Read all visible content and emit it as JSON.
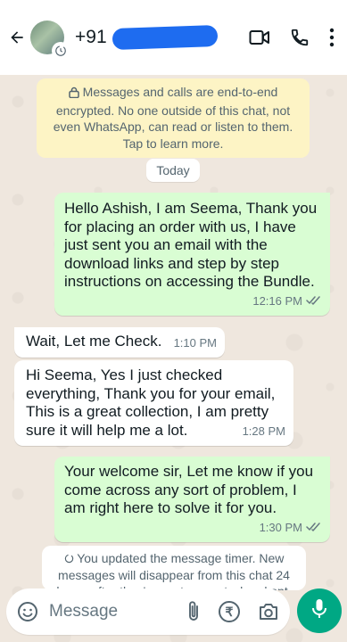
{
  "header": {
    "contact_name_visible": "+91",
    "back_icon": "arrow-left-icon",
    "video_icon": "video-camera-icon",
    "call_icon": "phone-icon",
    "menu_icon": "more-vertical-icon",
    "timer_icon": "disappearing-timer-icon"
  },
  "encryption_notice": {
    "text": "Messages and calls are end-to-end encrypted. No one outside of this chat, not even WhatsApp, can read or listen to them. Tap to learn more."
  },
  "date_chip": {
    "label": "Today"
  },
  "messages": [
    {
      "direction": "outgoing",
      "text": "Hello Ashish, I am Seema, Thank you for placing an order with us, I have just sent you an email with the download links and step by step instructions on accessing the Bundle.",
      "time": "12:16 PM",
      "status": "read"
    },
    {
      "direction": "incoming",
      "text": "Wait, Let me Check.",
      "time": "1:10 PM"
    },
    {
      "direction": "incoming",
      "text": "Hi Seema, Yes I just checked everything, Thank you for your email, This is a great collection, I am pretty sure it will help me a lot.",
      "time": "1:28 PM"
    },
    {
      "direction": "outgoing",
      "text": "Your welcome sir, Let me know if you come across any sort of problem, I am right here to solve it for you.",
      "time": "1:30 PM",
      "status": "read"
    }
  ],
  "system_note": {
    "text": "You updated the message timer. New messages will disappear from this chat 24 hours after they're sent, except when kept."
  },
  "composer": {
    "placeholder": "Message",
    "emoji_icon": "emoji-icon",
    "attach_icon": "paperclip-icon",
    "payment_symbol": "₹",
    "camera_icon": "camera-icon",
    "mic_icon": "microphone-icon"
  },
  "colors": {
    "outgoing_bubble": "#d9fdd3",
    "incoming_bubble": "#ffffff",
    "encryption_bg": "#fdf4c5",
    "accent": "#00a884",
    "read_ticks": "#53bdeb"
  }
}
